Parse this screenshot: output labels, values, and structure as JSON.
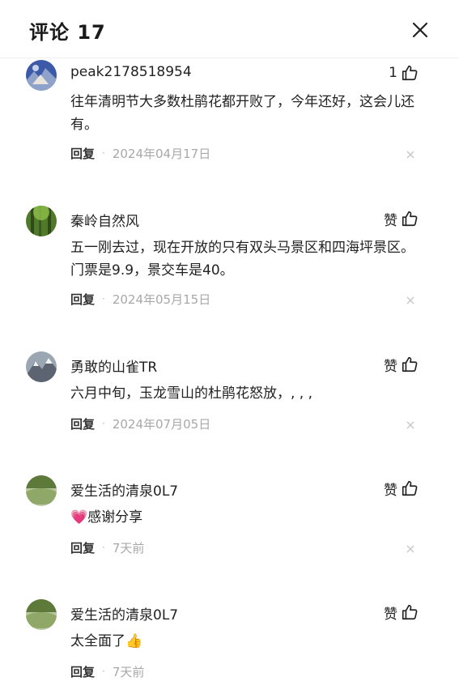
{
  "header": {
    "title": "评论 17"
  },
  "reply_label": "回复",
  "comments": [
    {
      "username": "peak2178518954",
      "like_label": "1",
      "text": "往年清明节大多数杜鹃花都开败了，今年还好，这会儿还有。",
      "date": "2024年04月17日",
      "avatar": "mountain-blue-photo"
    },
    {
      "username": "秦岭自然风",
      "like_label": "赞",
      "text": "五一刚去过，现在开放的只有双头马景区和四海坪景区。门票是9.9，景交车是40。",
      "date": "2024年05月15日",
      "avatar": "green-forest-photo"
    },
    {
      "username": "勇敢的山雀TR",
      "like_label": "赞",
      "text": "六月中旬，玉龙雪山的杜鹃花怒放，, , ,",
      "date": "2024年07月05日",
      "avatar": "snow-mountain-photo"
    },
    {
      "username": "爱生活的清泉0L7",
      "like_label": "赞",
      "text_emoji": "💗",
      "text": "感谢分享",
      "date": "7天前",
      "avatar": "green-field-photo"
    },
    {
      "username": "爱生活的清泉0L7",
      "like_label": "赞",
      "text": "太全面了",
      "text_emoji_after": "👍",
      "date": "7天前",
      "avatar": "green-field-photo"
    }
  ],
  "colors": {
    "text": "#222222",
    "meta": "#a8a8a8",
    "divider": "#eeeeee",
    "heart": "#e14b8f"
  }
}
